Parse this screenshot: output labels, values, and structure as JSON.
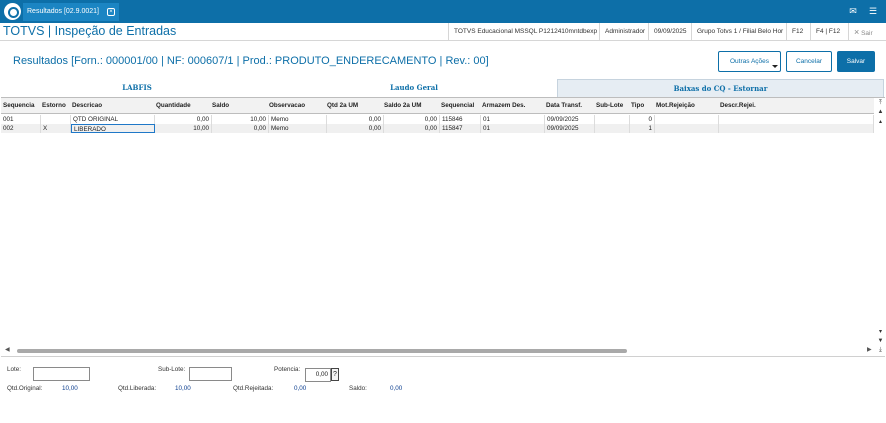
{
  "window": {
    "tab_title": "Resultados [02.9.0021]",
    "tab_close": "×",
    "mail_icon": "mail-icon",
    "menu_icon": "hamburger-icon"
  },
  "header": {
    "app_title": "TOTVS | Inspeção de Entradas",
    "database": "TOTVS Educacional MSSQL P1212410mntdbexp",
    "user": "Administrador",
    "date": "09/09/2025",
    "branch": "Grupo Totvs 1 / Filial Belo Hor",
    "shortcut_f12": "F12",
    "shortcut_f4": "F4 | F12",
    "exit_label": "Sair",
    "exit_icon": "×"
  },
  "results_title": "Resultados [Forn.: 000001/00 | NF: 000607/1 | Prod.: PRODUTO_ENDERECAMENTO | Rev.: 00]",
  "actions": {
    "other_actions": "Outras Ações",
    "cancel": "Cancelar",
    "save": "Salvar"
  },
  "tabs": [
    {
      "label": "LABFIS",
      "active": false
    },
    {
      "label": "Laudo Geral",
      "active": false
    },
    {
      "label": "Baixas do CQ - Estornar",
      "active": true
    }
  ],
  "grid": {
    "columns": [
      "Sequencia",
      "Estorno",
      "Descricao",
      "Quantidade",
      "Saldo",
      "Observacao",
      "Qtd 2a UM",
      "Saldo 2a UM",
      "Sequencial",
      "Armazem Des.",
      "Data Transf.",
      "Sub-Lote",
      "Tipo",
      "Mot.Rejeição",
      "Descr.Rejei."
    ],
    "rows": [
      {
        "seq": "001",
        "estorno": "",
        "descricao": "QTD ORIGINAL",
        "quantidade": "0,00",
        "saldo": "10,00",
        "obs": "Memo",
        "qtd2um": "0,00",
        "saldo2um": "0,00",
        "sequencial": "115846",
        "armazem": "01",
        "data": "09/09/2025",
        "sublote": "",
        "tipo": "0",
        "motrej": "",
        "descrej": ""
      },
      {
        "seq": "002",
        "estorno": "X",
        "descricao": "LIBERADO",
        "quantidade": "10,00",
        "saldo": "0,00",
        "obs": "Memo",
        "qtd2um": "0,00",
        "saldo2um": "0,00",
        "sequencial": "115847",
        "armazem": "01",
        "data": "09/09/2025",
        "sublote": "",
        "tipo": "1",
        "motrej": "",
        "descrej": ""
      }
    ]
  },
  "footer": {
    "lote_label": "Lote:",
    "lote_value": "",
    "sublote_label": "Sub-Lote:",
    "sublote_value": "",
    "potencia_label": "Potencia:",
    "potencia_value": "0,00",
    "potencia_help": "?",
    "qtd_original_label": "Qtd.Original:",
    "qtd_original_value": "10,00",
    "qtd_liberada_label": "Qtd.Liberada:",
    "qtd_liberada_value": "10,00",
    "qtd_rejeitada_label": "Qtd.Rejeitada:",
    "qtd_rejeitada_value": "0,00",
    "saldo_label": "Saldo:",
    "saldo_value": "0,00"
  }
}
